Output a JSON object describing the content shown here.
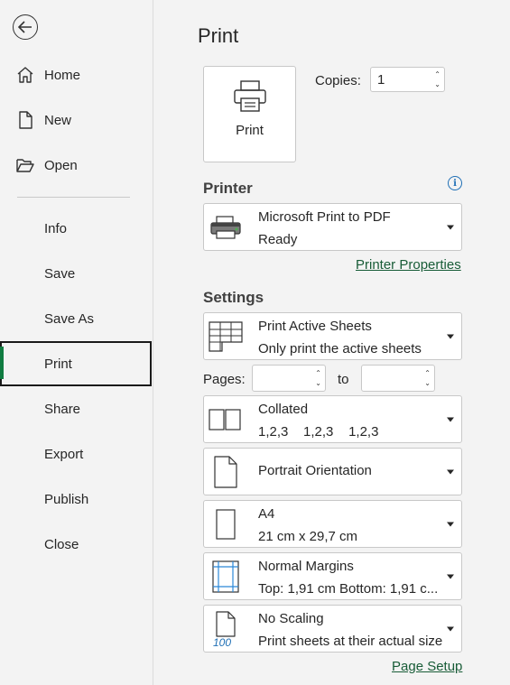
{
  "sidebar": {
    "items": [
      {
        "label": "Home",
        "icon": "home-icon"
      },
      {
        "label": "New",
        "icon": "new-file-icon"
      },
      {
        "label": "Open",
        "icon": "folder-open-icon"
      },
      {
        "label": "Info"
      },
      {
        "label": "Save"
      },
      {
        "label": "Save As"
      },
      {
        "label": "Print",
        "active": true
      },
      {
        "label": "Share"
      },
      {
        "label": "Export"
      },
      {
        "label": "Publish"
      },
      {
        "label": "Close"
      }
    ]
  },
  "main": {
    "title": "Print",
    "print_button": "Print",
    "copies_label": "Copies:",
    "copies_value": "1",
    "printer_section": "Printer",
    "printer": {
      "name": "Microsoft Print to PDF",
      "status": "Ready"
    },
    "printer_properties": "Printer Properties",
    "settings_section": "Settings",
    "pages_label": "Pages:",
    "pages_to": "to",
    "settings": {
      "print_what": {
        "title": "Print Active Sheets",
        "subtitle": "Only print the active sheets"
      },
      "collation": {
        "title": "Collated",
        "subtitle": "1,2,3    1,2,3    1,2,3"
      },
      "orientation": {
        "title": "Portrait Orientation"
      },
      "paper": {
        "title": "A4",
        "subtitle": "21 cm x 29,7 cm"
      },
      "margins": {
        "title": "Normal Margins",
        "subtitle": "Top: 1,91 cm Bottom: 1,91 c..."
      },
      "scaling": {
        "title": "No Scaling",
        "subtitle": "Print sheets at their actual size",
        "icon_text": "100"
      }
    },
    "page_setup": "Page Setup"
  },
  "colors": {
    "accent": "#107c41",
    "link": "#185c37",
    "info": "#1f6fb5"
  }
}
